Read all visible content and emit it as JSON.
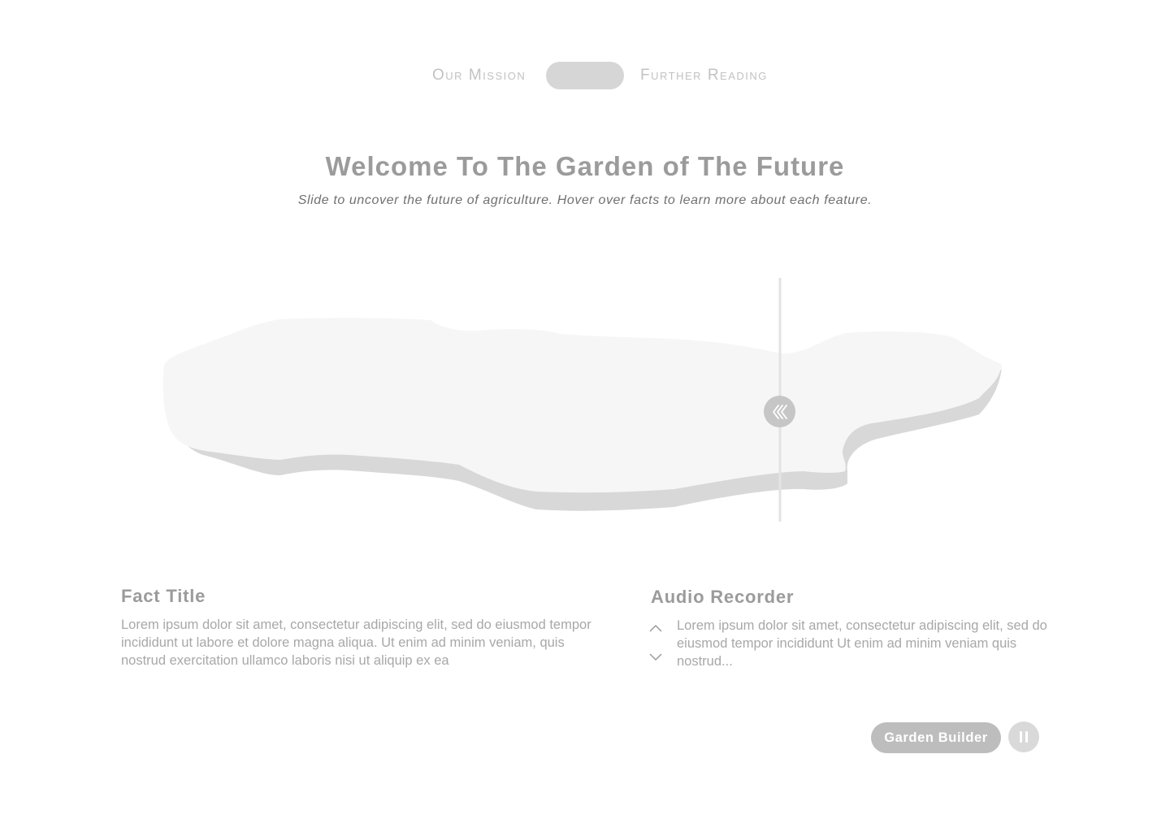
{
  "nav": {
    "left_link": "Our Mission",
    "right_link": "Further Reading"
  },
  "header": {
    "title": "Welcome To The Garden of The Future",
    "subtitle": "Slide to uncover the future of agriculture. Hover over facts to learn more about each feature."
  },
  "slider": {
    "handle_icon": "double-chevron-left-icon"
  },
  "fact": {
    "title": "Fact Title",
    "body": "Lorem ipsum dolor sit amet, consectetur adipiscing elit, sed do eiusmod tempor incididunt ut labore et dolore magna aliqua. Ut enim ad minim veniam, quis nostrud exercitation ullamco laboris nisi ut aliquip ex ea"
  },
  "audio": {
    "title": "Audio Recorder",
    "body": "Lorem ipsum dolor sit amet, consectetur adipiscing elit, sed do eiusmod tempor incididunt Ut enim ad minim veniam quis nostrud...",
    "up_icon": "chevron-up-icon",
    "down_icon": "chevron-down-icon"
  },
  "controls": {
    "builder_label": "Garden Builder",
    "pause_icon": "pause-icon"
  },
  "colors": {
    "land_top": "#f6f6f6",
    "land_side": "#d8d8d8",
    "text_muted": "#9b9b9b",
    "pill": "#d6d6d6",
    "button": "#bdbdbd"
  }
}
